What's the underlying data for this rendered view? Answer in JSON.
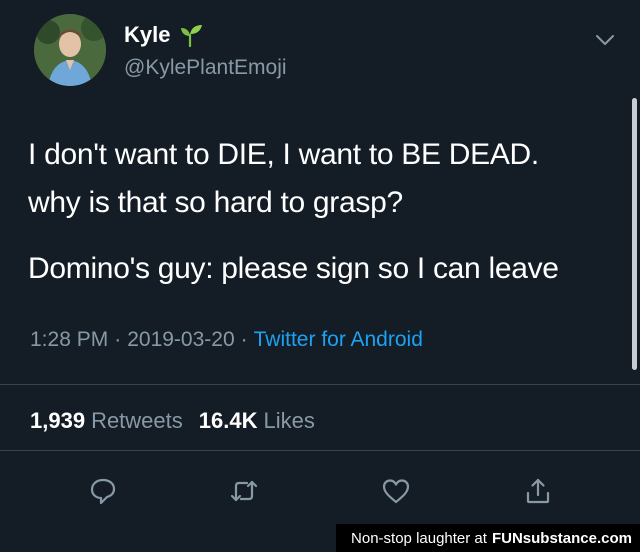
{
  "tweet": {
    "display_name": "Kyle",
    "name_emoji_icon": "seedling-icon",
    "handle": "@KylePlantEmoji",
    "lines": [
      "I don't want to DIE, I want to BE DEAD.",
      "why is that so hard to grasp?",
      "Domino's guy: please sign so I can leave"
    ],
    "time": "1:28 PM",
    "date": "2019-03-20",
    "source": "Twitter for Android",
    "separator": "·",
    "retweets_count": "1,939",
    "retweets_label": "Retweets",
    "likes_count": "16.4K",
    "likes_label": "Likes",
    "actions": [
      "reply-icon",
      "retweet-icon",
      "like-icon",
      "share-icon"
    ]
  },
  "watermark": {
    "text": "Non-stop laughter at",
    "brand": "FUNsubstance.com"
  },
  "colors": {
    "background": "#141d26",
    "muted_text": "#8899a6",
    "link": "#1da1f2",
    "divider": "#38444d"
  }
}
